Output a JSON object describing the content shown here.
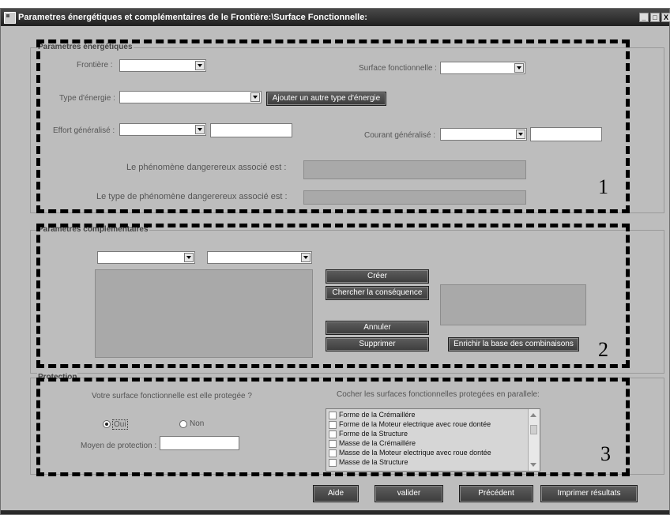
{
  "window": {
    "title": "Parametres énergétiques et complémentaires de le Frontière:\\Surface Fonctionnelle:",
    "controls": [
      "_",
      "□",
      "X"
    ]
  },
  "energy": {
    "group_label": "Parametres énergétiques",
    "frontiere_label": "Frontière :",
    "frontiere_value": "",
    "surface_label": "Surface fonctionnelle :",
    "surface_value": "",
    "type_label": "Type d'énergie :",
    "type_value": "",
    "add_type_button": "Ajouter un autre type d'énergie",
    "effort_label": "Effort généralisé :",
    "effort_value": "",
    "effort_text": "",
    "courant_label": "Courant généralisé :",
    "courant_value": "",
    "courant_text": "",
    "phenomene_label": "Le phénomène dangerereux associé est :",
    "phenomene_value": "",
    "type_phenomene_label": "Le type de phénomène dangerereux associé est :",
    "type_phenomene_value": ""
  },
  "complementary": {
    "group_label": "Parametres complémentaires",
    "combo1_value": "",
    "combo2_value": "",
    "create_button": "Créer",
    "search_button": "Chercher la conséquence",
    "cancel_button": "Annuler",
    "delete_button": "Supprimer",
    "enrich_button": "Enrichir la base des combinaisons"
  },
  "protection": {
    "group_label": "Protection",
    "question": "Votre surface fonctionnelle est elle protegée ?",
    "yes_label": "Oui",
    "no_label": "Non",
    "selected": "Oui",
    "means_label": "Moyen de protection :",
    "means_value": "",
    "list_title": "Cocher les surfaces fonctionnelles protegées en parallele:",
    "list_items": [
      "Forme de la Crémaillére",
      "Forme de la Moteur electrique avec roue dontée",
      "Forme de la Structure",
      "Masse de la Crémaillére",
      "Masse de la Moteur electrique avec roue dontée",
      "Masse de la Structure"
    ]
  },
  "footer": {
    "help_button": "Aide",
    "validate_button": "valider",
    "previous_button": "Précédent",
    "print_button": "Imprimer résultats"
  },
  "annotations": {
    "section1": "1",
    "section2": "2",
    "section3": "3"
  }
}
